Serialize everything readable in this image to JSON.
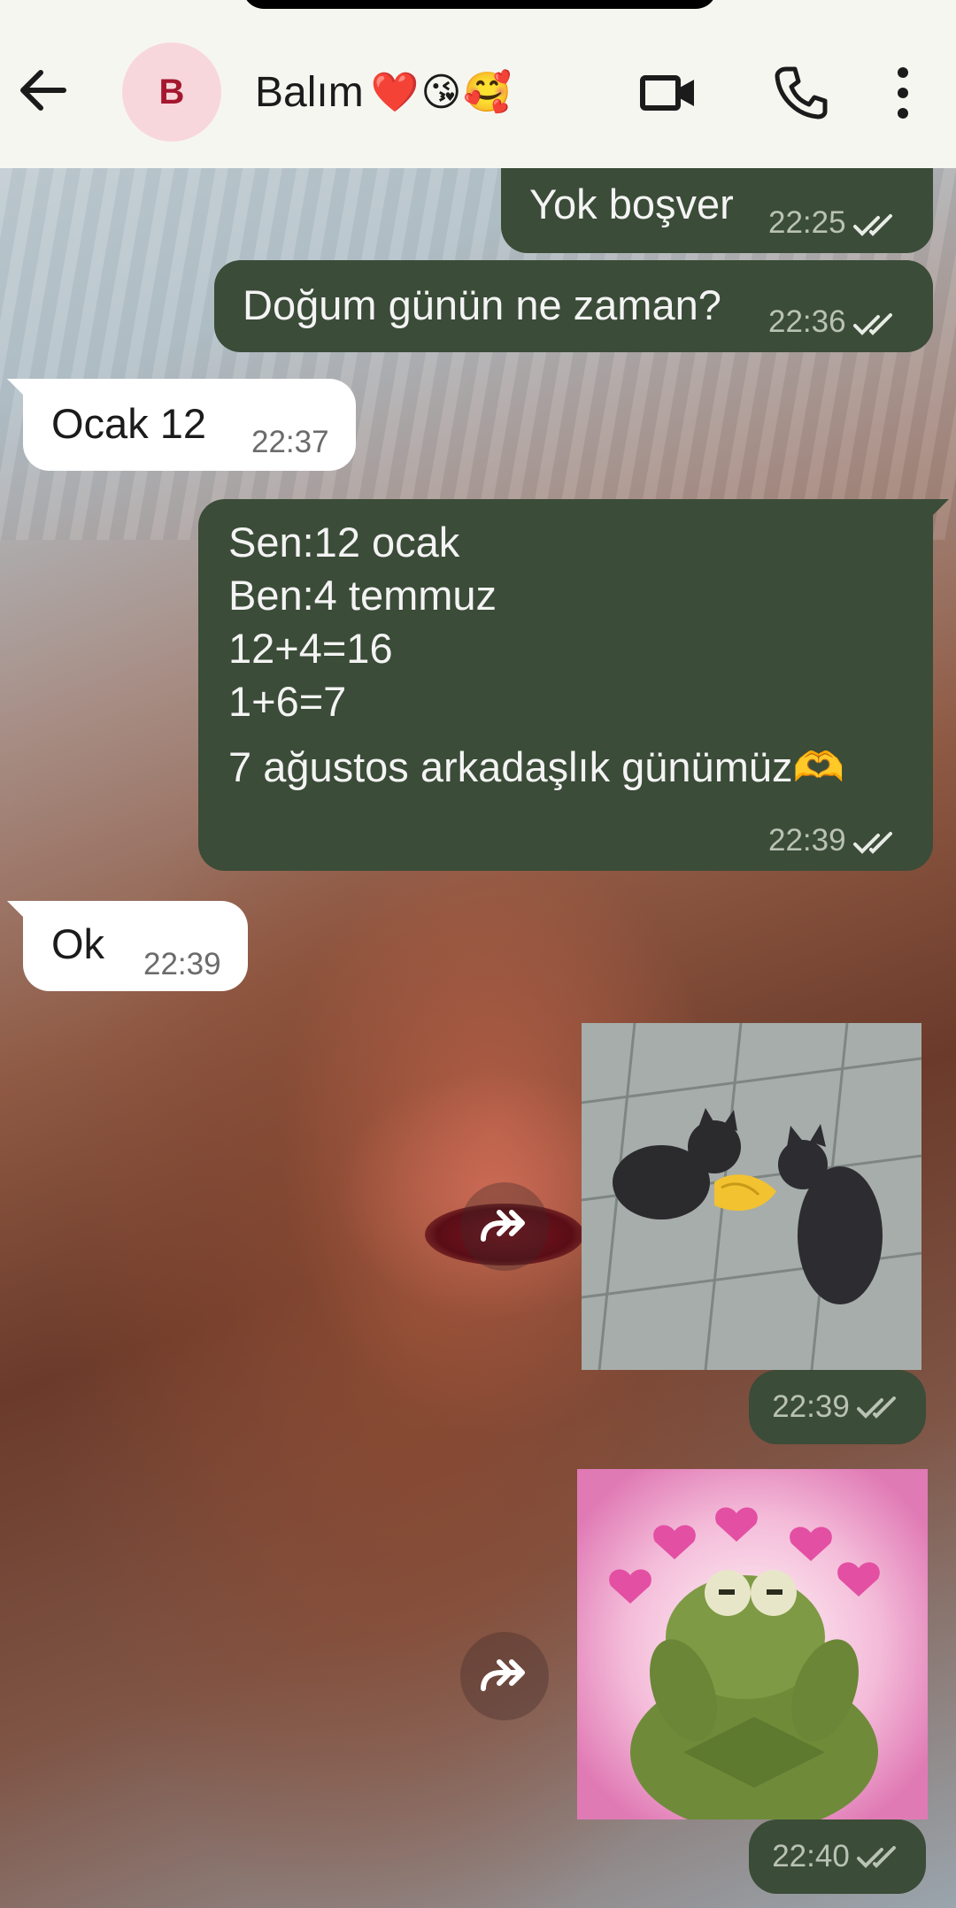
{
  "header": {
    "contact_name": "Balım",
    "contact_emojis": "❤️😘🥰",
    "avatar_initial": "B",
    "icons": {
      "back": "arrow-left-icon",
      "video": "video-camera-icon",
      "call": "phone-icon",
      "menu": "more-vertical-icon"
    }
  },
  "messages": [
    {
      "direction": "out",
      "text": "Yok boşver",
      "time": "22:25",
      "status": "read"
    },
    {
      "direction": "out",
      "text": "Doğum günün ne zaman?",
      "time": "22:36",
      "status": "read"
    },
    {
      "direction": "in",
      "text": "Ocak 12",
      "time": "22:37"
    },
    {
      "direction": "out",
      "lines": [
        "Sen:12 ocak",
        "Ben:4 temmuz",
        "12+4=16",
        "1+6=7",
        "7 ağustos arkadaşlık günümüz🫶"
      ],
      "time": "22:39",
      "status": "read"
    },
    {
      "direction": "in",
      "text": "Ok",
      "time": "22:39"
    },
    {
      "direction": "out",
      "type": "sticker",
      "sticker": "cats-handshake-sticker",
      "time": "22:39",
      "status": "delivered"
    },
    {
      "direction": "out",
      "type": "sticker",
      "sticker": "kermit-hearts-sticker",
      "time": "22:40",
      "status": "delivered"
    }
  ],
  "colors": {
    "outgoing_bubble": "#3b4c38",
    "incoming_bubble": "#ffffff",
    "header_bg": "#f6f6f1",
    "avatar_bg": "#f8d7dc",
    "avatar_text": "#a3172f"
  }
}
